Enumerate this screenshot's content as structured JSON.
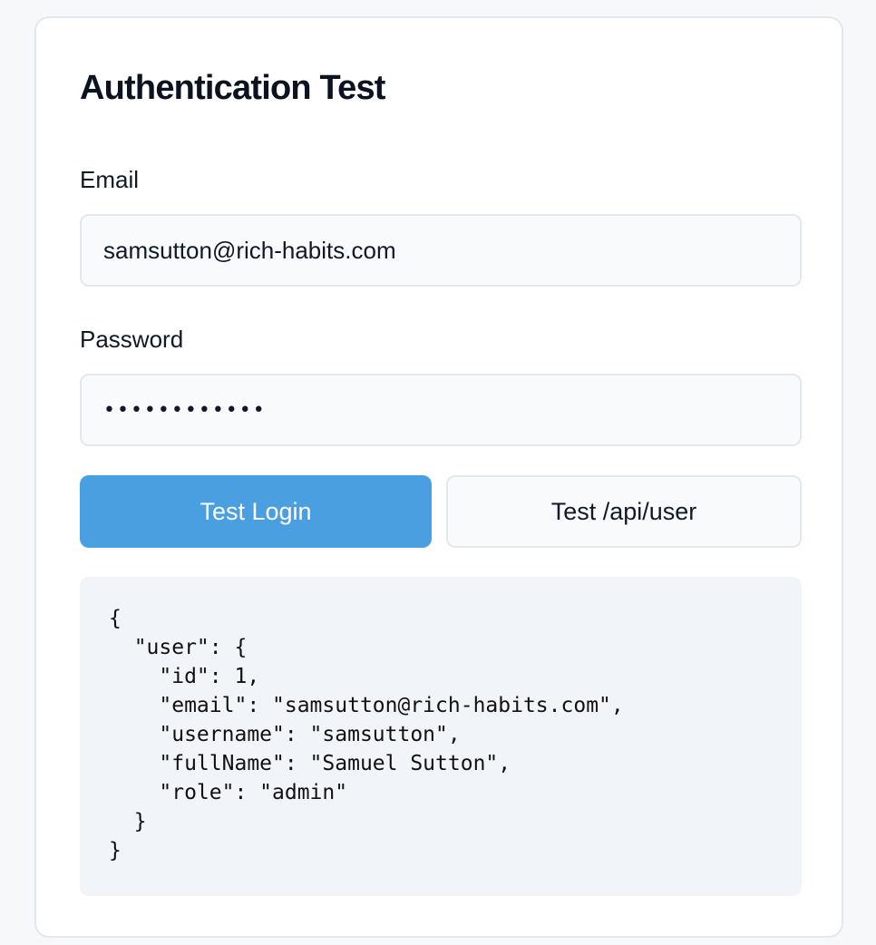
{
  "card": {
    "title": "Authentication Test"
  },
  "form": {
    "email_label": "Email",
    "email_value": "samsutton@rich-habits.com",
    "password_label": "Password",
    "password_mask": "••••••••••••"
  },
  "actions": {
    "login_label": "Test Login",
    "user_label": "Test /api/user"
  },
  "response": {
    "text": "{\n  \"user\": {\n    \"id\": 1,\n    \"email\": \"samsutton@rich-habits.com\",\n    \"username\": \"samsutton\",\n    \"fullName\": \"Samuel Sutton\",\n    \"role\": \"admin\"\n  }\n}"
  },
  "colors": {
    "primary": "#4a9fe0",
    "border": "#e3e7ee",
    "input_bg": "#f8fafc",
    "code_bg": "#f1f4f9"
  }
}
